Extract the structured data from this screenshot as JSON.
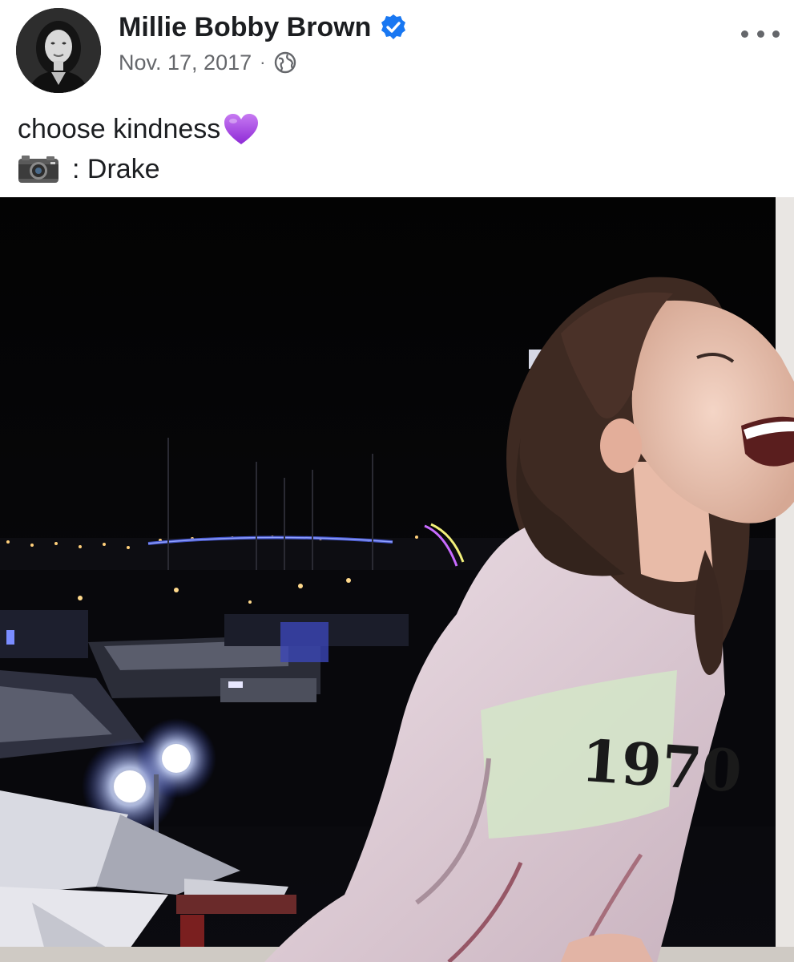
{
  "post": {
    "author_name": "Millie Bobby Brown",
    "date": "Nov. 17, 2017",
    "separator": "·",
    "caption_line1": "choose kindness",
    "caption_line2": ": Drake",
    "photo_shirt_text": "1970"
  },
  "icons": {
    "verified": "verified-badge-icon",
    "audience": "globe-icon",
    "more": "more-options-icon",
    "heart": "purple-heart-emoji",
    "camera": "camera-emoji"
  },
  "colors": {
    "name_text": "#1c1e21",
    "meta_text": "#65676b",
    "verified_blue": "#1877f2",
    "heart_purple": "#a23fe0"
  }
}
